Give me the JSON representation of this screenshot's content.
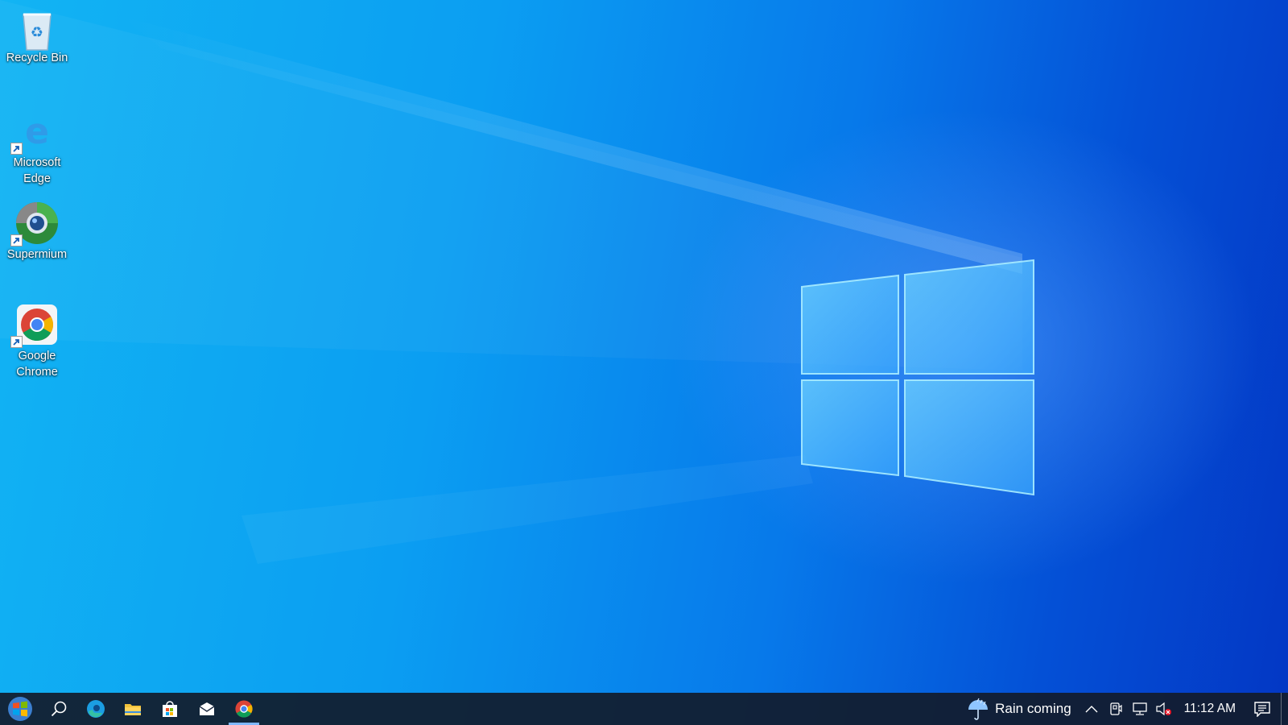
{
  "desktop": {
    "icons": [
      {
        "label": "Recycle Bin",
        "icon": "recycle-bin-icon"
      },
      {
        "label": "Microsoft\nEdge",
        "icon": "microsoft-edge-icon"
      },
      {
        "label": "Supermium",
        "icon": "supermium-icon"
      },
      {
        "label": "Google\nChrome",
        "icon": "google-chrome-icon"
      }
    ]
  },
  "taskbar": {
    "start": {
      "icon": "windows-start-icon"
    },
    "pinned": [
      {
        "icon": "search-icon"
      },
      {
        "icon": "microsoft-edge-icon"
      },
      {
        "icon": "file-explorer-icon"
      },
      {
        "icon": "microsoft-store-icon"
      },
      {
        "icon": "mail-icon"
      },
      {
        "icon": "google-chrome-icon",
        "active": true
      }
    ],
    "tray": {
      "weather_text": "Rain coming",
      "weather_icon": "rain-umbrella-icon",
      "clock": "11:12 AM",
      "icons": [
        "chevron-up-icon",
        "meet-now-icon",
        "network-icon",
        "volume-muted-icon",
        "notifications-icon"
      ]
    }
  },
  "colors": {
    "wallpaper_light": "#12b4f3",
    "wallpaper_dark": "#0337c4",
    "taskbar": "#121c2c",
    "active_indicator": "#7fb8ff"
  }
}
